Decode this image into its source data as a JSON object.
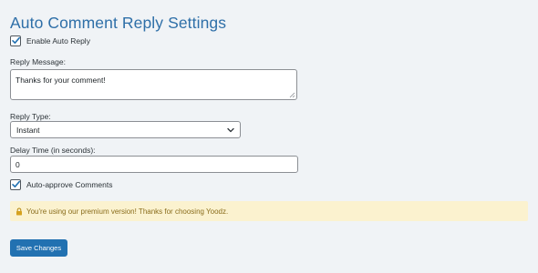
{
  "header": {
    "title": "Auto Comment Reply Settings"
  },
  "form": {
    "enable_auto_reply": {
      "label": "Enable Auto Reply",
      "checked": true
    },
    "reply_message": {
      "label": "Reply Message:",
      "value": "Thanks for your comment!"
    },
    "reply_type": {
      "label": "Reply Type:",
      "selected": "Instant"
    },
    "delay_time": {
      "label": "Delay Time (in seconds):",
      "value": "0"
    },
    "auto_approve": {
      "label": "Auto-approve Comments",
      "checked": true
    }
  },
  "notice": {
    "icon": "lock-icon",
    "text": "You're using our premium version! Thanks for choosing Yoodz."
  },
  "actions": {
    "save_label": "Save Changes"
  },
  "colors": {
    "title": "#2e6fa8",
    "primary_button": "#2271b1",
    "notice_bg": "#fbf2cf",
    "notice_text": "#8a6d1c",
    "checkmark": "#2271b1"
  }
}
